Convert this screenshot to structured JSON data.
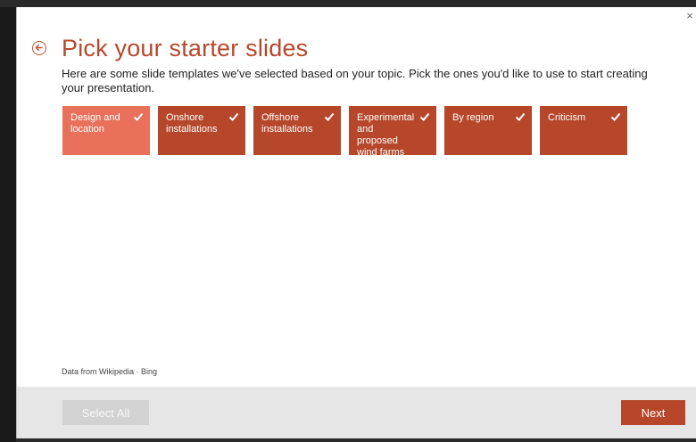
{
  "dialog": {
    "close_symbol": "×",
    "title": "Pick your starter slides",
    "subtitle": "Here are some slide templates we've selected based on your topic. Pick the ones you'd like to use to start creating your presentation.",
    "tiles": [
      {
        "label": "Design and location",
        "selected": true,
        "highlighted": true
      },
      {
        "label": "Onshore installations",
        "selected": true,
        "highlighted": false
      },
      {
        "label": "Offshore installations",
        "selected": true,
        "highlighted": false
      },
      {
        "label": "Experimental and proposed wind farms",
        "selected": true,
        "highlighted": false
      },
      {
        "label": "By region",
        "selected": true,
        "highlighted": false
      },
      {
        "label": "Criticism",
        "selected": true,
        "highlighted": false
      }
    ],
    "credit": "Data from Wikipedia · Bing"
  },
  "footer": {
    "select_all_label": "Select All",
    "next_label": "Next"
  },
  "colors": {
    "accent": "#b7472a",
    "tile_highlight": "#e9705a",
    "footer_bg": "#e6e6e6",
    "disabled_button": "#d2d2d2"
  },
  "icons": {
    "back": "back-arrow-circle-icon",
    "check": "checkmark-icon",
    "close": "close-icon"
  }
}
